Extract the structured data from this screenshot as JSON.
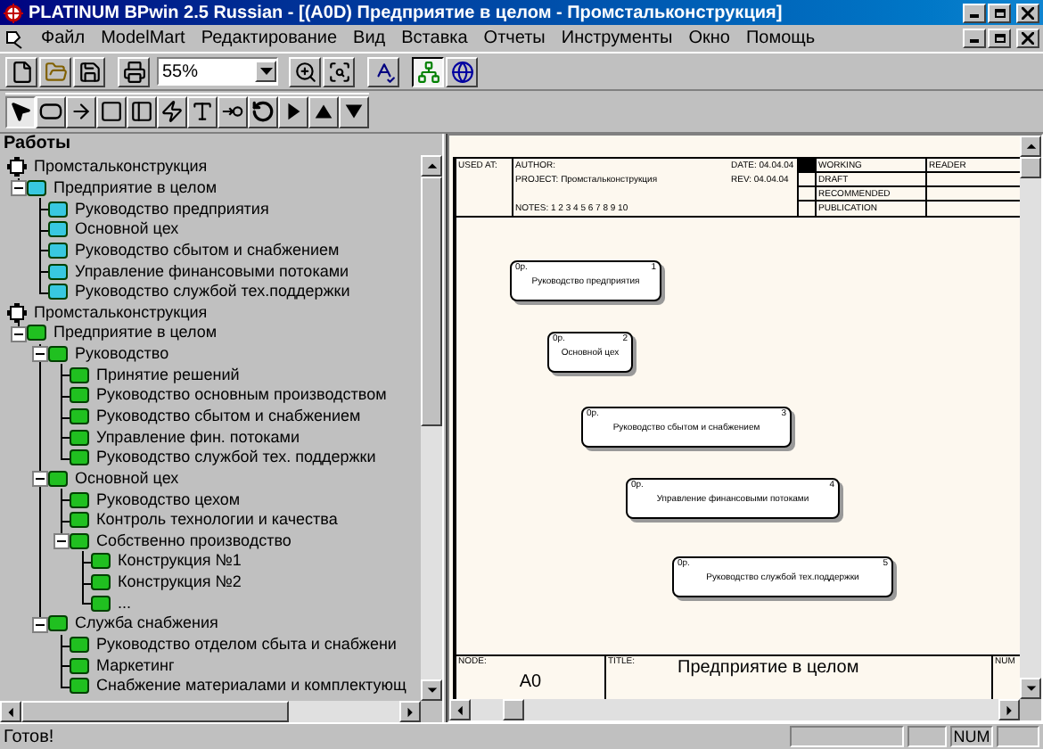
{
  "window": {
    "title": "PLATINUM BPwin 2.5 Russian - [(A0D) Предприятие в целом - Промстальконструкция]"
  },
  "menu": [
    "Файл",
    "ModelMart",
    "Редактирование",
    "Вид",
    "Вставка",
    "Отчеты",
    "Инструменты",
    "Окно",
    "Помощь"
  ],
  "toolbar": {
    "zoom": "55%",
    "buttons": [
      {
        "kind": "new",
        "pressed": false
      },
      {
        "kind": "open",
        "pressed": false
      },
      {
        "kind": "save",
        "pressed": false
      },
      {
        "kind": "print",
        "pressed": false
      },
      {
        "kind": "zoom-in",
        "pressed": false
      },
      {
        "kind": "zoom-fit",
        "pressed": false
      },
      {
        "kind": "spell",
        "pressed": false
      },
      {
        "kind": "tree",
        "pressed": true
      },
      {
        "kind": "globe",
        "pressed": false
      }
    ]
  },
  "tools": [
    {
      "kind": "pointer",
      "selected": true
    },
    {
      "kind": "activity",
      "selected": false
    },
    {
      "kind": "arrow",
      "selected": false
    },
    {
      "kind": "square",
      "selected": false
    },
    {
      "kind": "panel",
      "selected": false
    },
    {
      "kind": "squiggle",
      "selected": false
    },
    {
      "kind": "text",
      "selected": false
    },
    {
      "kind": "tunnel",
      "selected": false
    },
    {
      "kind": "rotate",
      "selected": false
    },
    {
      "kind": "right",
      "selected": false
    },
    {
      "kind": "up",
      "selected": false
    },
    {
      "kind": "down",
      "selected": false
    }
  ],
  "activities": {
    "title": "Работы",
    "tree": [
      {
        "kind": "model",
        "label": "Промстальконструкция",
        "children": [
          {
            "kind": "activity",
            "color": "#38c8e0",
            "label": "Предприятие в целом",
            "expanded": true,
            "children": [
              {
                "kind": "activity",
                "color": "#38c8e0",
                "label": "Руководство предприятия"
              },
              {
                "kind": "activity",
                "color": "#38c8e0",
                "label": "Основной цех"
              },
              {
                "kind": "activity",
                "color": "#38c8e0",
                "label": "Руководство сбытом и снабжением"
              },
              {
                "kind": "activity",
                "color": "#38c8e0",
                "label": "Управление финансовыми потоками"
              },
              {
                "kind": "activity",
                "color": "#38c8e0",
                "label": "Руководство службой тех.поддержки"
              }
            ]
          }
        ]
      },
      {
        "kind": "model",
        "label": "Промстальконструкция",
        "children": [
          {
            "kind": "activity",
            "color": "#20c020",
            "label": "Предприятие в целом",
            "expanded": true,
            "children": [
              {
                "kind": "activity",
                "color": "#20c020",
                "label": "Руководство",
                "expanded": true,
                "children": [
                  {
                    "kind": "activity",
                    "color": "#20c020",
                    "label": "Принятие решений"
                  },
                  {
                    "kind": "activity",
                    "color": "#20c020",
                    "label": "Руководство основным производством"
                  },
                  {
                    "kind": "activity",
                    "color": "#20c020",
                    "label": "Руководство сбытом и снабжением"
                  },
                  {
                    "kind": "activity",
                    "color": "#20c020",
                    "label": "Управление фин.  потоками"
                  },
                  {
                    "kind": "activity",
                    "color": "#20c020",
                    "label": "Руководство службой  тех. поддержки"
                  }
                ]
              },
              {
                "kind": "activity",
                "color": "#20c020",
                "label": "Основной цех",
                "expanded": true,
                "children": [
                  {
                    "kind": "activity",
                    "color": "#20c020",
                    "label": "Руководство цехом"
                  },
                  {
                    "kind": "activity",
                    "color": "#20c020",
                    "label": "Контроль технологии и качества"
                  },
                  {
                    "kind": "activity",
                    "color": "#20c020",
                    "label": "Собственно производство",
                    "expanded": true,
                    "children": [
                      {
                        "kind": "activity",
                        "color": "#20c020",
                        "label": "Конструкция №1"
                      },
                      {
                        "kind": "activity",
                        "color": "#20c020",
                        "label": "Конструкция №2"
                      },
                      {
                        "kind": "activity",
                        "color": "#20c020",
                        "label": "..."
                      }
                    ]
                  }
                ]
              },
              {
                "kind": "activity",
                "color": "#20c020",
                "label": "Служба снабжения",
                "expanded": true,
                "children": [
                  {
                    "kind": "activity",
                    "color": "#20c020",
                    "label": "Руководство отделом  сбыта и снабжени"
                  },
                  {
                    "kind": "activity",
                    "color": "#20c020",
                    "label": "Маркетинг"
                  },
                  {
                    "kind": "activity",
                    "color": "#20c020",
                    "label": "Снабжение материалами  и комплектующ"
                  }
                ]
              }
            ]
          }
        ]
      }
    ]
  },
  "diagram": {
    "header": {
      "used_at_label": "USED AT:",
      "author_label": "AUTHOR:",
      "project_label": "PROJECT:",
      "project": "Промстальконструкция",
      "notes_label": "NOTES:",
      "notes": "1 2 3 4 5 6 7 8 9 10",
      "date_label": "DATE:",
      "date": "04.04.04",
      "rev_label": "REV:",
      "rev": "04.04.04",
      "statuses": [
        {
          "label": "WORKING",
          "selected": true
        },
        {
          "label": "DRAFT",
          "selected": false
        },
        {
          "label": "RECOMMENDED",
          "selected": false
        },
        {
          "label": "PUBLICATION",
          "selected": false
        }
      ],
      "reader_label": "READER"
    },
    "boxes": [
      {
        "cost": "0р.",
        "number": "1",
        "label": "Руководство предприятия"
      },
      {
        "cost": "0р.",
        "number": "2",
        "label": "Основной цех"
      },
      {
        "cost": "0р.",
        "number": "3",
        "label": "Руководство сбытом и снабжением"
      },
      {
        "cost": "0р.",
        "number": "4",
        "label": "Управление финансовыми потоками"
      },
      {
        "cost": "0р.",
        "number": "5",
        "label": "Руководство службой тех.поддержки"
      }
    ],
    "footer": {
      "node_label": "NODE:",
      "node": "A0",
      "title_label": "TITLE:",
      "title": "Предприятие в целом",
      "number_label": "NUM"
    }
  },
  "status_bar": {
    "text": "Готов!",
    "num": "NUM"
  }
}
